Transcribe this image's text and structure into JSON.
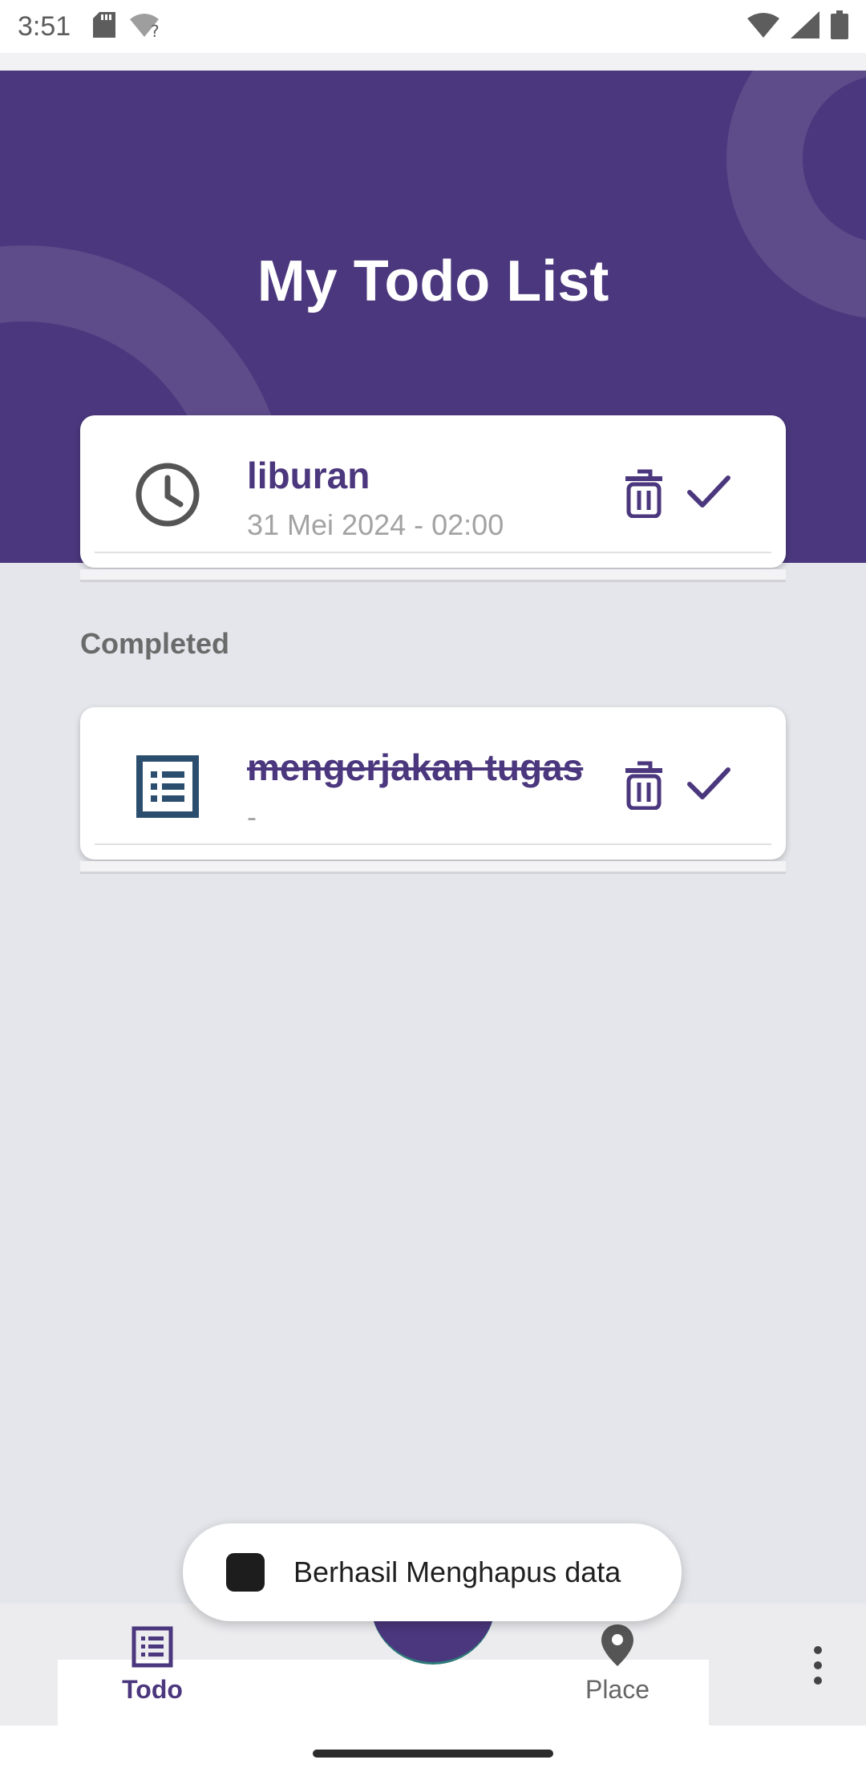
{
  "status_bar": {
    "time": "3:51",
    "icons": [
      "sd-card-icon",
      "wifi-unknown-icon",
      "wifi-icon",
      "signal-icon",
      "battery-icon"
    ]
  },
  "header": {
    "title": "My Todo List",
    "background_color": "#4b377d"
  },
  "todo": {
    "items": [
      {
        "title": "liburan",
        "subtitle": "31 Mei 2024 - 02:00",
        "icon": "clock-icon"
      }
    ]
  },
  "completed": {
    "label": "Completed",
    "items": [
      {
        "title": "mengerjakan tugas",
        "subtitle": "-",
        "icon": "list-icon"
      }
    ]
  },
  "bottom_nav": {
    "items": [
      {
        "label": "Todo",
        "icon": "list-icon",
        "active": true
      },
      {
        "label": "Place",
        "icon": "map-pin-icon",
        "active": false
      }
    ]
  },
  "snackbar": {
    "message": "Berhasil Menghapus data"
  },
  "colors": {
    "accent": "#4b377d",
    "card_text": "#4b377d",
    "page_background": "#e4e6eb"
  }
}
